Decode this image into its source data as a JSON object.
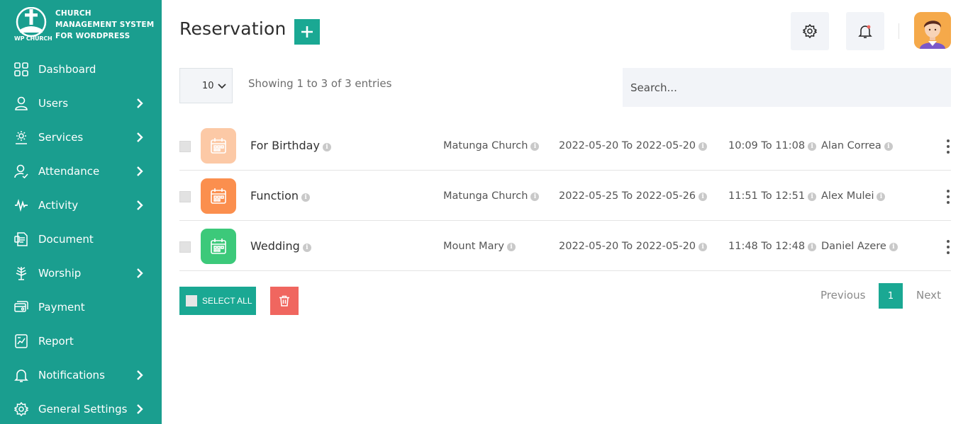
{
  "brand": {
    "title": "Church Management System For WordPress",
    "logo_text": "WP CHURCH"
  },
  "sidebar": {
    "items": [
      {
        "label": "Dashboard",
        "icon": "dashboard-icon",
        "has_submenu": false
      },
      {
        "label": "Users",
        "icon": "user-icon",
        "has_submenu": true
      },
      {
        "label": "Services",
        "icon": "services-icon",
        "has_submenu": true
      },
      {
        "label": "Attendance",
        "icon": "attendance-icon",
        "has_submenu": true
      },
      {
        "label": "Activity",
        "icon": "activity-icon",
        "has_submenu": true
      },
      {
        "label": "Document",
        "icon": "document-icon",
        "has_submenu": false
      },
      {
        "label": "Worship",
        "icon": "worship-icon",
        "has_submenu": true
      },
      {
        "label": "Payment",
        "icon": "payment-icon",
        "has_submenu": false
      },
      {
        "label": "Report",
        "icon": "report-icon",
        "has_submenu": false
      },
      {
        "label": "Notifications",
        "icon": "bell-icon",
        "has_submenu": true
      },
      {
        "label": "General Settings",
        "icon": "gear-icon",
        "has_submenu": true
      }
    ]
  },
  "header": {
    "title": "Reservation",
    "add_label": "+"
  },
  "controls": {
    "page_size": "10",
    "entries_info": "Showing 1 to 3 of 3 entries",
    "search_placeholder": "Search..."
  },
  "rows": [
    {
      "name": "For Birthday",
      "place": "Matunga Church",
      "date": "2022-05-20 To 2022-05-20",
      "time": "10:09 To 11:08",
      "person": "Alan Correa",
      "icon_color": "#fcc9a6"
    },
    {
      "name": "Function",
      "place": "Matunga Church",
      "date": "2022-05-25 To 2022-05-26",
      "time": "11:51 To 12:51",
      "person": "Alex Mulei",
      "icon_color": "#fb8f4e"
    },
    {
      "name": "Wedding",
      "place": "Mount Mary",
      "date": "2022-05-20 To 2022-05-20",
      "time": "11:48 To 12:48",
      "person": "Daniel Azere",
      "icon_color": "#3cc97a"
    }
  ],
  "footer": {
    "select_all": "SELECT ALL",
    "previous": "Previous",
    "current_page": "1",
    "next": "Next"
  },
  "colors": {
    "sidebar": "#1a9e8f",
    "accent": "#1aa893",
    "danger": "#f0665f"
  }
}
